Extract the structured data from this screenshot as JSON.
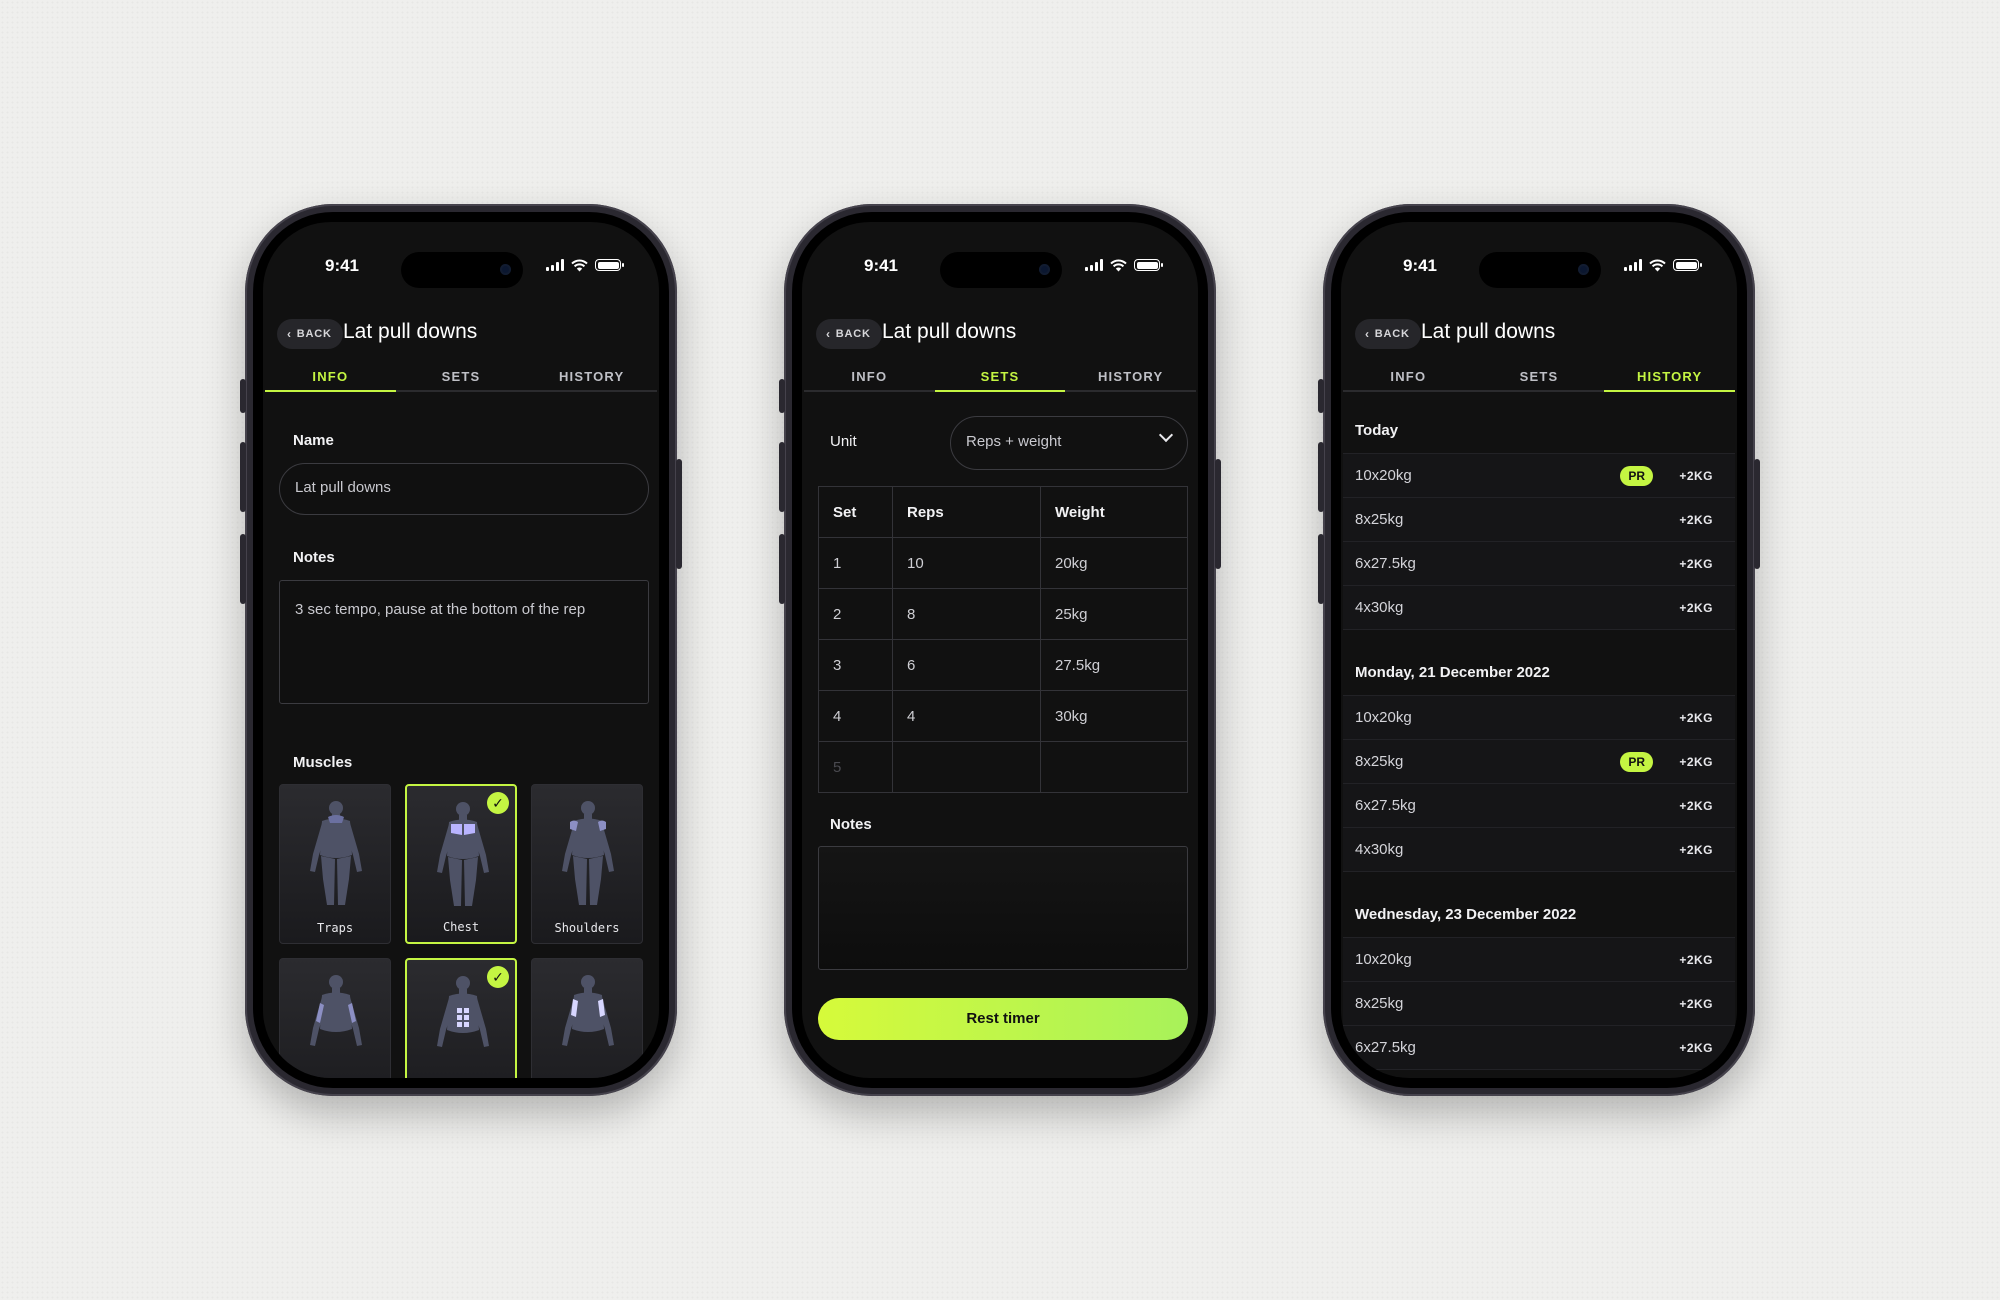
{
  "status": {
    "time": "9:41"
  },
  "header": {
    "back_label": "BACK",
    "title": "Lat pull downs"
  },
  "tabs": [
    {
      "label": "INFO"
    },
    {
      "label": "SETS"
    },
    {
      "label": "HISTORY"
    }
  ],
  "info": {
    "name_label": "Name",
    "name_value": "Lat pull downs",
    "notes_label": "Notes",
    "notes_value": "3 sec tempo, pause at the bottom of the rep",
    "muscles_label": "Muscles",
    "muscles": [
      {
        "name": "Traps",
        "selected": false
      },
      {
        "name": "Chest",
        "selected": true
      },
      {
        "name": "Shoulders",
        "selected": false
      },
      {
        "name": "",
        "selected": false
      },
      {
        "name": "",
        "selected": true
      },
      {
        "name": "",
        "selected": false
      }
    ]
  },
  "sets": {
    "unit_label": "Unit",
    "unit_value": "Reps + weight",
    "columns": [
      "Set",
      "Reps",
      "Weight"
    ],
    "rows": [
      [
        "1",
        "10",
        "20kg"
      ],
      [
        "2",
        "8",
        "25kg"
      ],
      [
        "3",
        "6",
        "27.5kg"
      ],
      [
        "4",
        "4",
        "30kg"
      ],
      [
        "5",
        "",
        ""
      ]
    ],
    "notes_label": "Notes",
    "notes_value": "",
    "rest_timer_label": "Rest timer"
  },
  "history": {
    "sections": [
      {
        "date": "Today",
        "rows": [
          {
            "text": "10x20kg",
            "pr": true,
            "inc": "+2KG"
          },
          {
            "text": "8x25kg",
            "pr": false,
            "inc": "+2KG"
          },
          {
            "text": "6x27.5kg",
            "pr": false,
            "inc": "+2KG"
          },
          {
            "text": "4x30kg",
            "pr": false,
            "inc": "+2KG"
          }
        ]
      },
      {
        "date": "Monday, 21 December 2022",
        "rows": [
          {
            "text": "10x20kg",
            "pr": false,
            "inc": "+2KG"
          },
          {
            "text": "8x25kg",
            "pr": true,
            "inc": "+2KG"
          },
          {
            "text": "6x27.5kg",
            "pr": false,
            "inc": "+2KG"
          },
          {
            "text": "4x30kg",
            "pr": false,
            "inc": "+2KG"
          }
        ]
      },
      {
        "date": "Wednesday, 23 December 2022",
        "rows": [
          {
            "text": "10x20kg",
            "pr": false,
            "inc": "+2KG"
          },
          {
            "text": "8x25kg",
            "pr": false,
            "inc": "+2KG"
          },
          {
            "text": "6x27.5kg",
            "pr": false,
            "inc": "+2KG"
          }
        ]
      }
    ],
    "pr_label": "PR"
  },
  "colors": {
    "accent": "#c4f542",
    "background": "#111111",
    "muscle_highlight": "#b9b4ff"
  }
}
